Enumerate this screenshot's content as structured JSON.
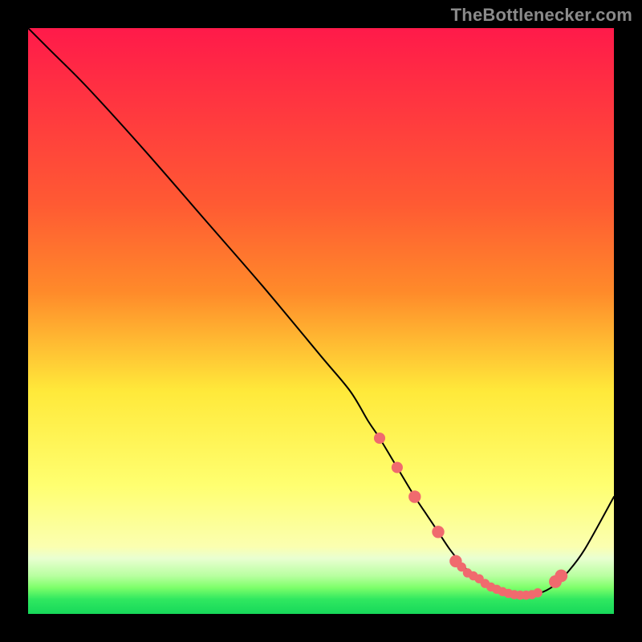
{
  "watermark": "TheBottlenecker.com",
  "colors": {
    "gradient_top": "#ff1a4a",
    "gradient_mid_upper": "#ff8a2a",
    "gradient_mid": "#ffe93a",
    "gradient_lower": "#fbffb0",
    "gradient_green1": "#7eff6a",
    "gradient_green2": "#17d85a",
    "curve": "#000000",
    "marker": "#f06a6e",
    "ylabel_band": "#e9ffd1"
  },
  "chart_data": {
    "type": "line",
    "title": "",
    "xlabel": "",
    "ylabel": "",
    "xlim": [
      0,
      100
    ],
    "ylim": [
      0,
      100
    ],
    "series": [
      {
        "name": "curve",
        "x": [
          0,
          4,
          10,
          20,
          30,
          40,
          50,
          55,
          58,
          60,
          63,
          66,
          68,
          70,
          72,
          74,
          76,
          78,
          80,
          82,
          84,
          86,
          88,
          90,
          92,
          95,
          100
        ],
        "y": [
          100,
          96,
          90,
          79,
          67.5,
          56,
          44,
          38,
          33,
          30,
          25,
          20,
          17,
          14,
          11,
          8.5,
          6.5,
          5,
          4,
          3.4,
          3.2,
          3.3,
          3.8,
          5,
          7,
          11,
          20
        ]
      }
    ],
    "markers": {
      "x": [
        60,
        63,
        66,
        70,
        73,
        74,
        75,
        76,
        77,
        78,
        79,
        80,
        81,
        82,
        83,
        84,
        85,
        86,
        87,
        90,
        91
      ],
      "y": [
        30,
        25,
        20,
        14,
        9,
        8,
        7,
        6.5,
        6,
        5.2,
        4.6,
        4.2,
        3.8,
        3.5,
        3.3,
        3.2,
        3.2,
        3.3,
        3.6,
        5.5,
        6.5
      ],
      "r": [
        3.2,
        3.2,
        3.5,
        3.5,
        3.5,
        2.6,
        2.6,
        2.6,
        2.6,
        2.6,
        2.6,
        2.6,
        2.6,
        2.6,
        2.6,
        2.6,
        2.6,
        2.6,
        2.6,
        3.6,
        3.6
      ]
    }
  }
}
